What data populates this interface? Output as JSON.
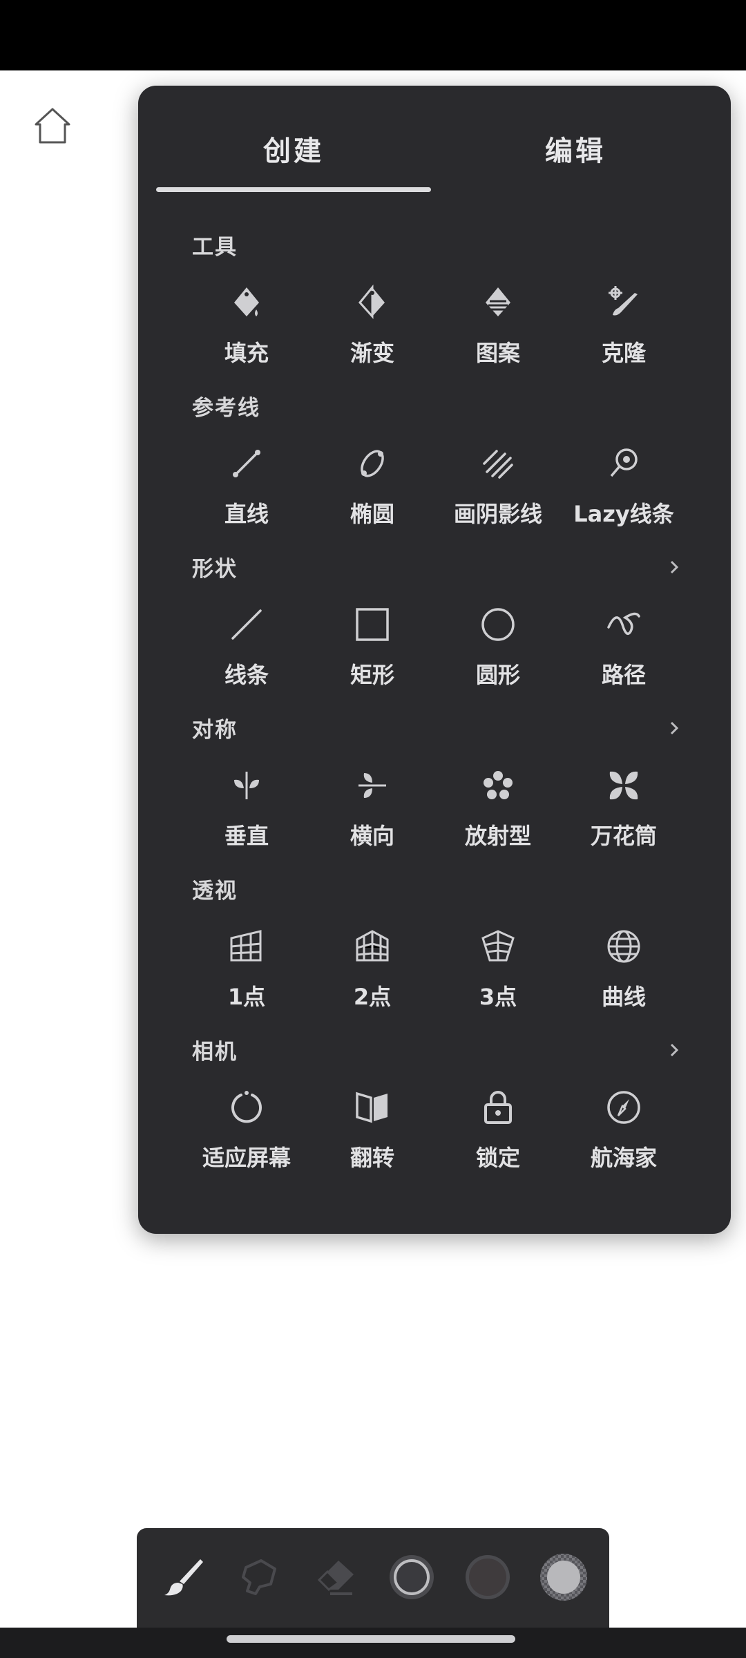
{
  "tabs": {
    "create": "创建",
    "edit": "编辑",
    "active": "create"
  },
  "sections": [
    {
      "title": "工具",
      "items": [
        {
          "label": "填充",
          "icon": "fill-bucket-icon"
        },
        {
          "label": "渐变",
          "icon": "gradient-icon"
        },
        {
          "label": "图案",
          "icon": "pattern-icon"
        },
        {
          "label": "克隆",
          "icon": "clone-icon"
        }
      ]
    },
    {
      "title": "参考线",
      "items": [
        {
          "label": "直线",
          "icon": "line-guide-icon"
        },
        {
          "label": "椭圆",
          "icon": "ellipse-guide-icon"
        },
        {
          "label": "画阴影线",
          "icon": "hatch-icon"
        },
        {
          "label": "Lazy线条",
          "icon": "lazy-line-icon"
        }
      ]
    },
    {
      "title": "形状",
      "items": [
        {
          "label": "线条",
          "icon": "line-shape-icon"
        },
        {
          "label": "矩形",
          "icon": "rectangle-icon"
        },
        {
          "label": "圆形",
          "icon": "circle-icon"
        },
        {
          "label": "路径",
          "icon": "path-icon"
        }
      ]
    },
    {
      "title": "对称",
      "items": [
        {
          "label": "垂直",
          "icon": "vertical-symmetry-icon"
        },
        {
          "label": "横向",
          "icon": "horizontal-symmetry-icon"
        },
        {
          "label": "放射型",
          "icon": "radial-symmetry-icon"
        },
        {
          "label": "万花筒",
          "icon": "kaleidoscope-icon"
        }
      ]
    },
    {
      "title": "透视",
      "items": [
        {
          "label": "1点",
          "icon": "perspective-1pt-icon"
        },
        {
          "label": "2点",
          "icon": "perspective-2pt-icon"
        },
        {
          "label": "3点",
          "icon": "perspective-3pt-icon"
        },
        {
          "label": "曲线",
          "icon": "globe-curve-icon"
        }
      ]
    },
    {
      "title": "相机",
      "items": [
        {
          "label": "适应屏幕",
          "icon": "fit-screen-icon"
        },
        {
          "label": "翻转",
          "icon": "flip-icon"
        },
        {
          "label": "锁定",
          "icon": "lock-icon"
        },
        {
          "label": "航海家",
          "icon": "compass-icon"
        }
      ]
    }
  ],
  "bottom_toolbar": [
    "brush-icon",
    "smudge-icon",
    "eraser-icon",
    "brush-size-icon",
    "color-swatch-icon",
    "opacity-icon"
  ],
  "colors": {
    "panel": "#2a2a2d",
    "accent": "#dcdcde",
    "swatch": "#4a4648"
  }
}
